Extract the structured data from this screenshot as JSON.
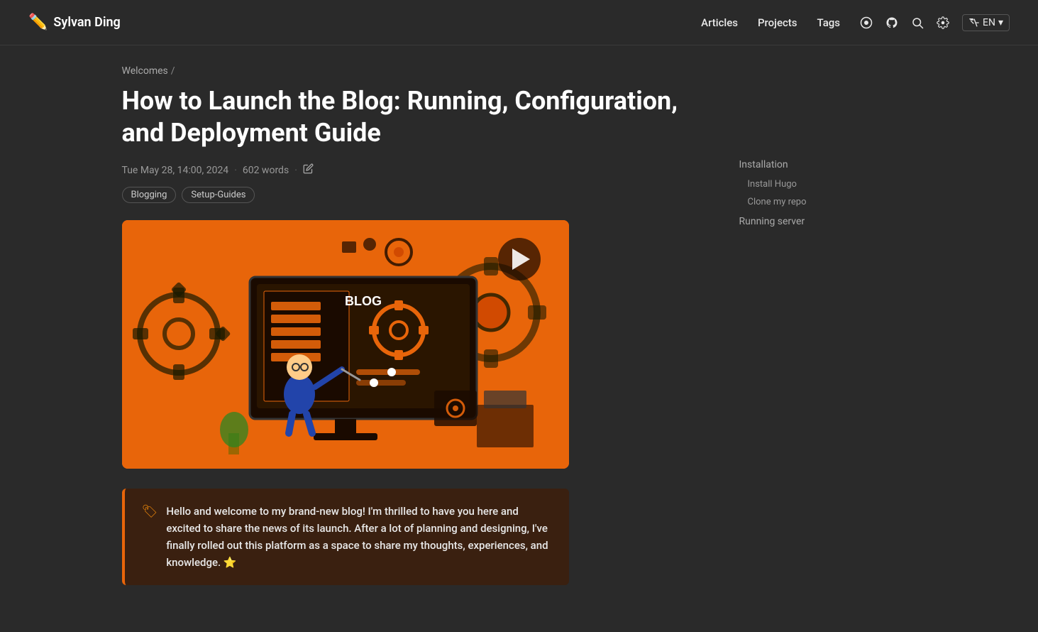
{
  "nav": {
    "brand_label": "Sylvan Ding",
    "links": [
      {
        "label": "Articles",
        "href": "#"
      },
      {
        "label": "Projects",
        "href": "#"
      },
      {
        "label": "Tags",
        "href": "#"
      }
    ],
    "lang_label": "EN"
  },
  "breadcrumb": {
    "parent": "Welcomes",
    "separator": "/"
  },
  "article": {
    "title": "How to Launch the Blog: Running, Configuration, and Deployment Guide",
    "date": "Tue May 28, 14:00, 2024",
    "word_count": "602 words",
    "tags": [
      "Blogging",
      "Setup-Guides"
    ]
  },
  "callout": {
    "text": "Hello and welcome to my brand-new blog! I'm thrilled to have you here and excited to share the news of its launch. After a lot of planning and designing, I've finally rolled out this platform as a space to share my thoughts, experiences, and knowledge. ⭐"
  },
  "sidebar": {
    "sections": [
      {
        "title": "Installation",
        "items": [
          "Install Hugo",
          "Clone my repo"
        ]
      },
      {
        "title": "Running server",
        "items": []
      }
    ]
  }
}
